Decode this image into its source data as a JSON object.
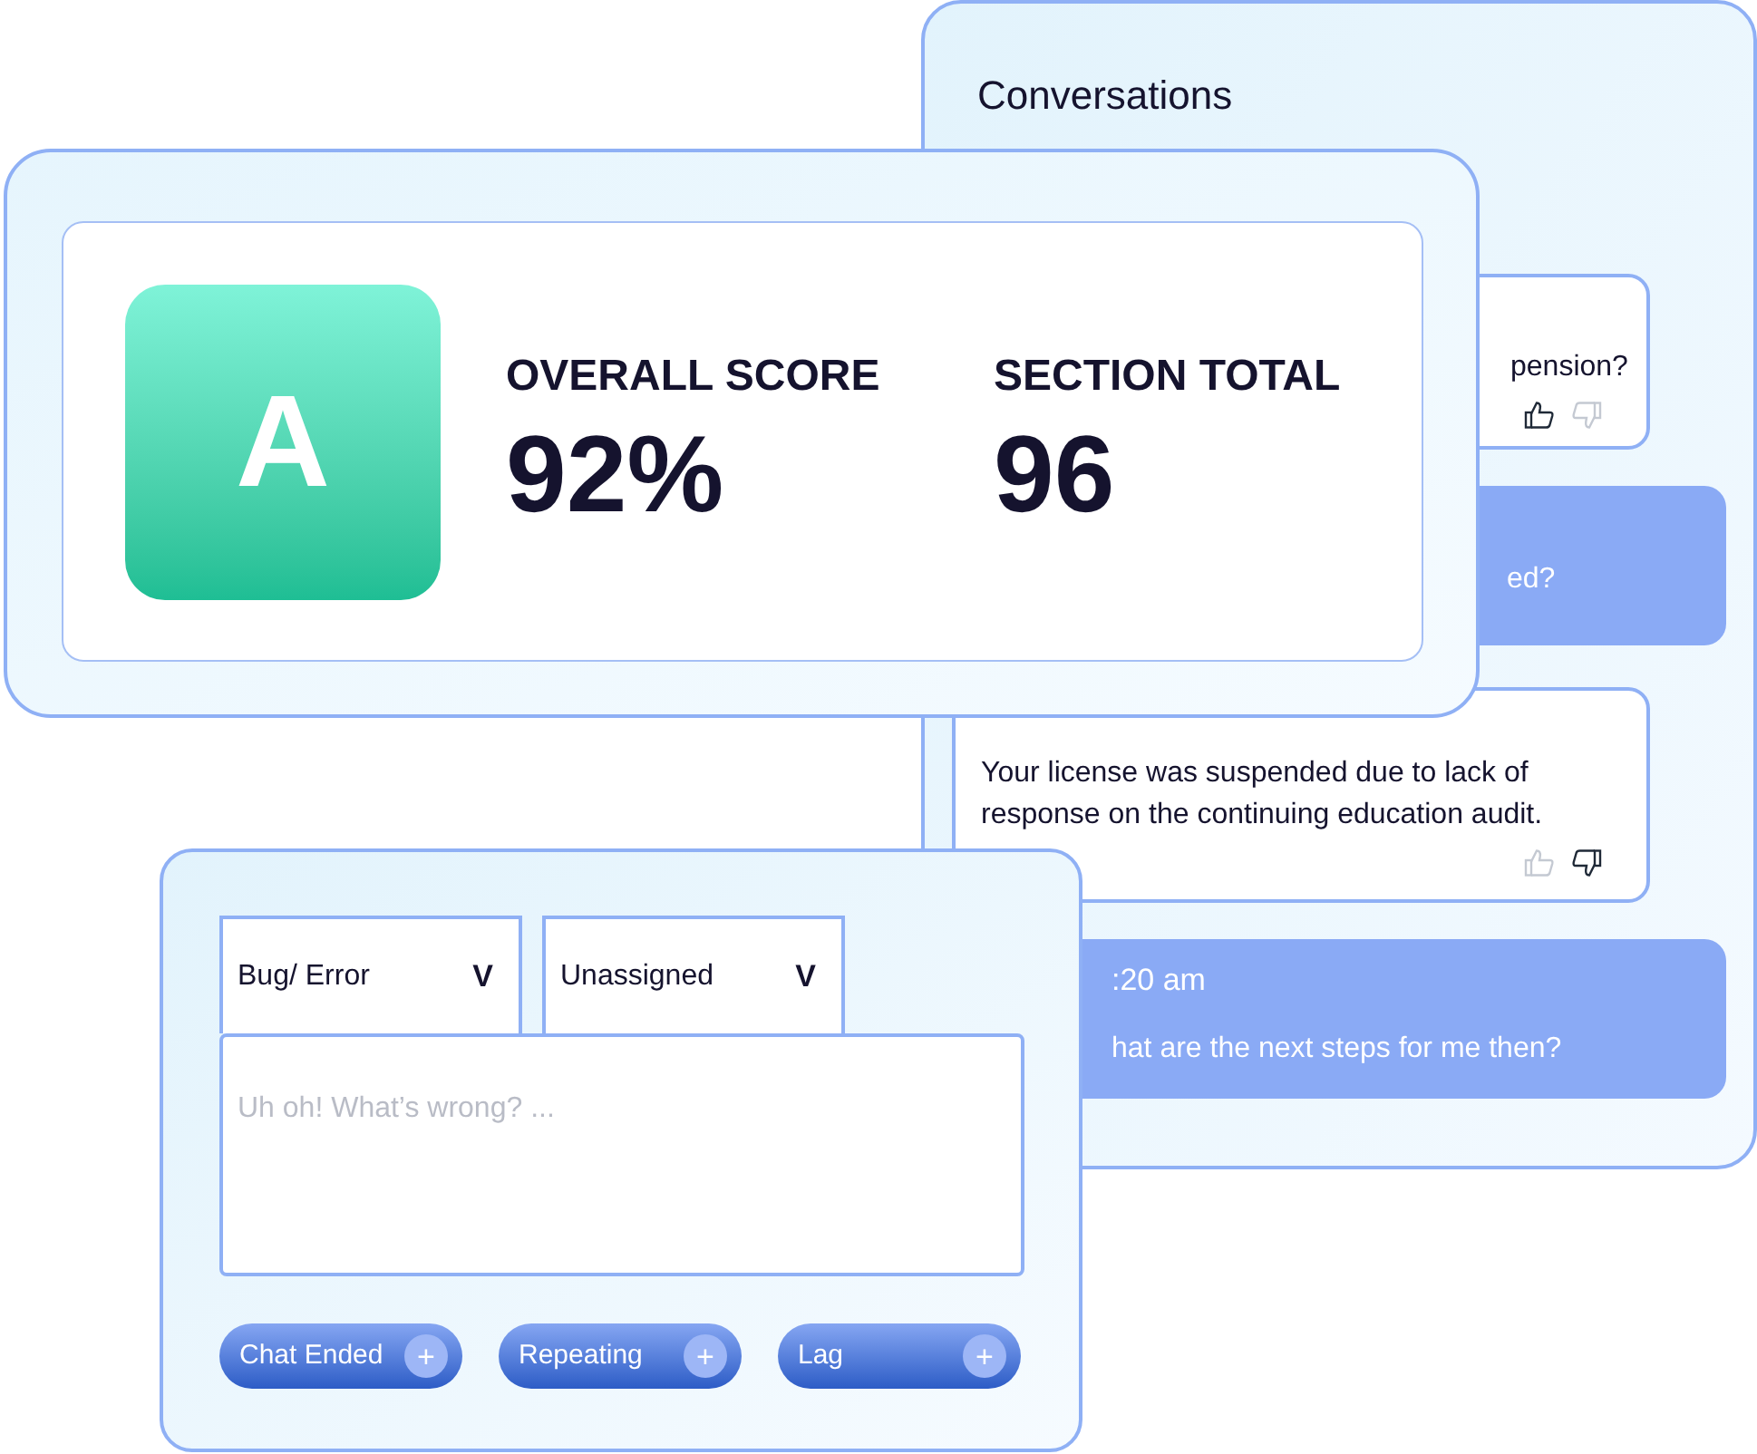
{
  "conversations": {
    "title": "Conversations",
    "messages": [
      {
        "kind": "agent",
        "text": "pension?",
        "liked": true,
        "disliked": false
      },
      {
        "kind": "user",
        "text": "ed?"
      },
      {
        "kind": "agent",
        "text": "Your license was suspended due to lack of response on the continuing education audit.",
        "liked": false,
        "disliked": true
      },
      {
        "kind": "user",
        "time": ":20 am",
        "text": "hat are the next steps for me then?"
      }
    ]
  },
  "score": {
    "grade": "A",
    "stats": [
      {
        "label": "OVERALL SCORE",
        "value": "92%"
      },
      {
        "label": "SECTION TOTAL",
        "value": "96"
      }
    ]
  },
  "report": {
    "selects": [
      {
        "value": "Bug/ Error",
        "caret": "V"
      },
      {
        "value": "Unassigned",
        "caret": "V"
      }
    ],
    "textarea": {
      "placeholder": "Uh oh! What’s wrong? ..."
    },
    "tags": [
      {
        "label": "Chat Ended",
        "plus": "+"
      },
      {
        "label": "Repeating",
        "plus": "+"
      },
      {
        "label": "Lag",
        "plus": "+"
      }
    ]
  }
}
